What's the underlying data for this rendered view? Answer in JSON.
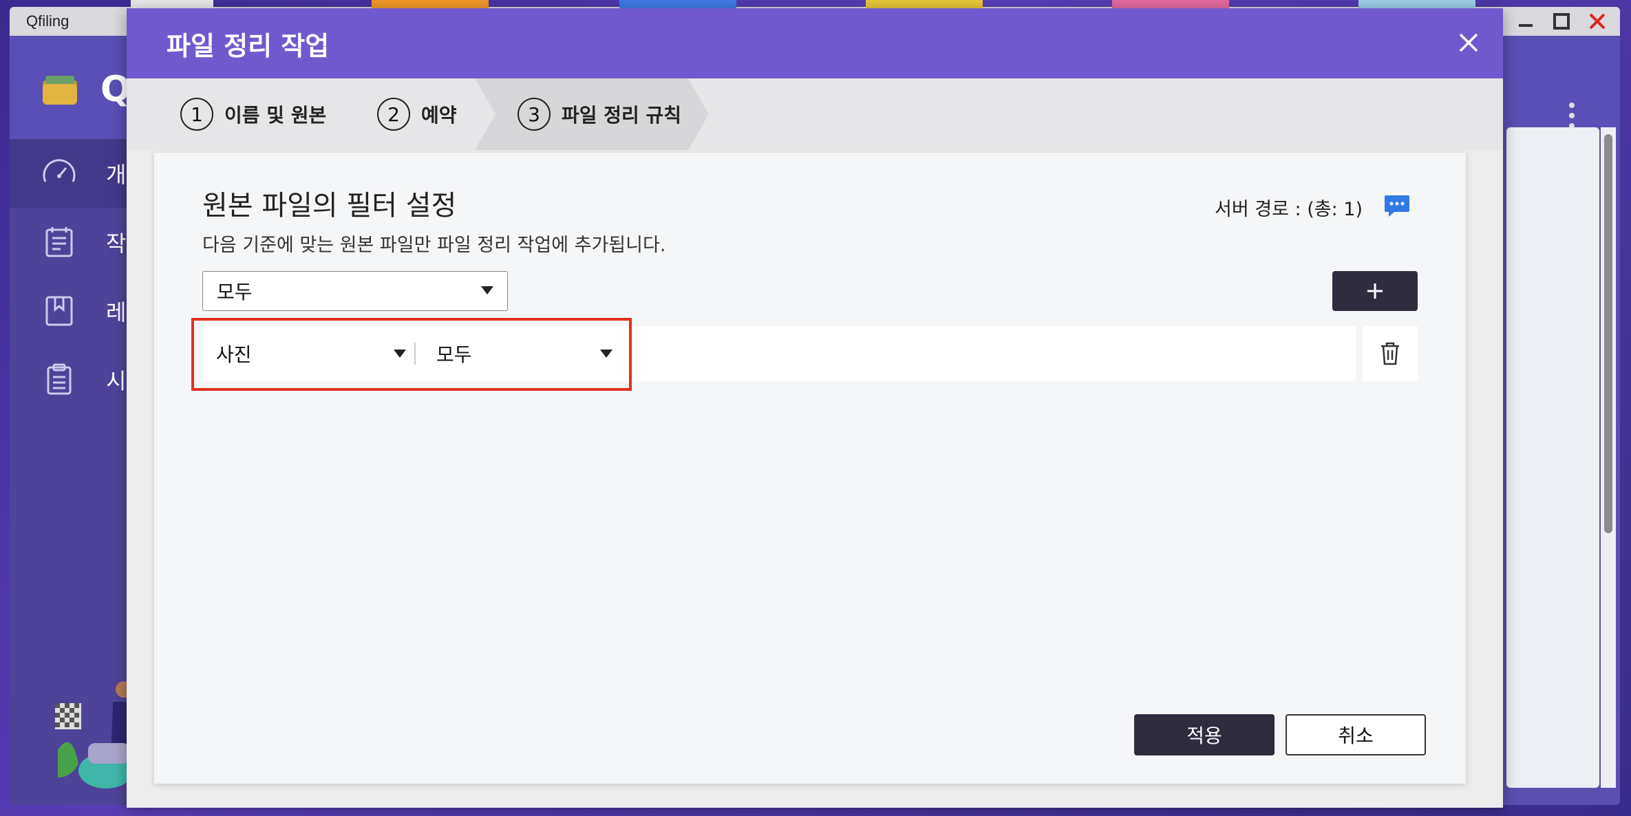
{
  "app": {
    "title": "Qfiling",
    "logo_letter": "Q",
    "nav": [
      {
        "label": "개",
        "icon": "dashboard-icon"
      },
      {
        "label": "작",
        "icon": "tasks-icon"
      },
      {
        "label": "레",
        "icon": "bookmark-icon"
      },
      {
        "label": "시",
        "icon": "clipboard-icon"
      }
    ]
  },
  "dialog": {
    "title": "파일 정리 작업",
    "steps": [
      {
        "num": "1",
        "label": "이름 및 원본"
      },
      {
        "num": "2",
        "label": "예약"
      },
      {
        "num": "3",
        "label": "파일 정리 규칙"
      }
    ],
    "section_title": "원본 파일의 필터 설정",
    "section_desc": "다음 기준에 맞는 원본 파일만 파일 정리 작업에 추가됩니다.",
    "server_path": "서버 경로 : (총: 1)",
    "match_select": "모두",
    "rule": {
      "type": "사진",
      "condition": "모두"
    },
    "apply_label": "적용",
    "cancel_label": "취소"
  },
  "colors": {
    "header": "#7059cf",
    "highlight": "#e0321e",
    "primary_button": "#2f2c3e"
  }
}
